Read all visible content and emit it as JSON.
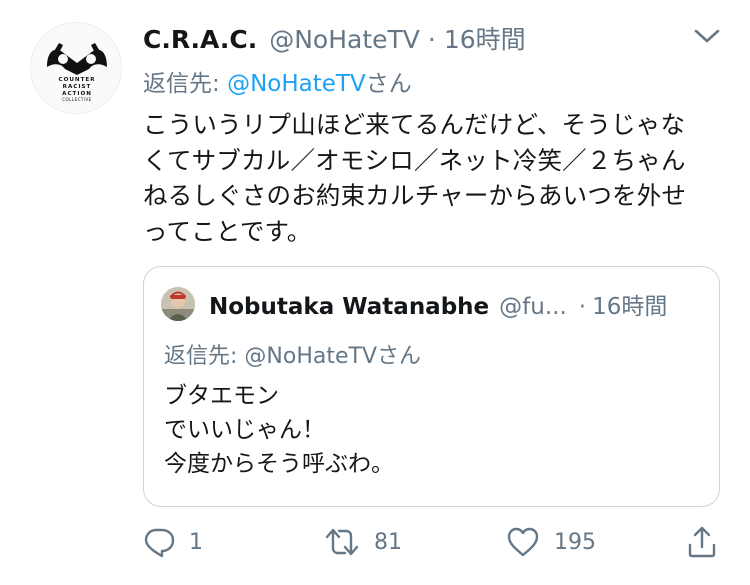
{
  "author": {
    "display_name": "C.R.A.C.",
    "handle": "@NoHateTV",
    "separator": "·",
    "time": "16時間",
    "avatar_text": [
      "COUNTER",
      "RACIST",
      "ACTION",
      "COLLECTIVE"
    ]
  },
  "reply": {
    "prefix": "返信先: ",
    "mention": "@NoHateTV",
    "suffix": "さん"
  },
  "text": "こういうリプ山ほど来てるんだけど、そうじゃな\nくてサブカル／オモシロ／ネット冷笑／２ちゃん\nねるしぐさのお約束カルチャーからあいつを外せ\nってことです。",
  "quote": {
    "display_name": "Nobutaka Watanabhe",
    "handle": "@fu...",
    "separator": "·",
    "time": "16時間",
    "reply_line": "返信先: @NoHateTVさん",
    "text": "ブタエモン\nでいいじゃん！\n今度からそう呼ぶわ。"
  },
  "actions": {
    "reply_count": "1",
    "retweet_count": "81",
    "like_count": "195"
  },
  "icons": {
    "menu": "chevron-down-icon",
    "reply": "reply-icon",
    "retweet": "retweet-icon",
    "like": "heart-icon",
    "share": "share-icon"
  },
  "colors": {
    "text": "#14171a",
    "secondary": "#657786",
    "link": "#1da1f2",
    "border": "#ccd6dd"
  }
}
